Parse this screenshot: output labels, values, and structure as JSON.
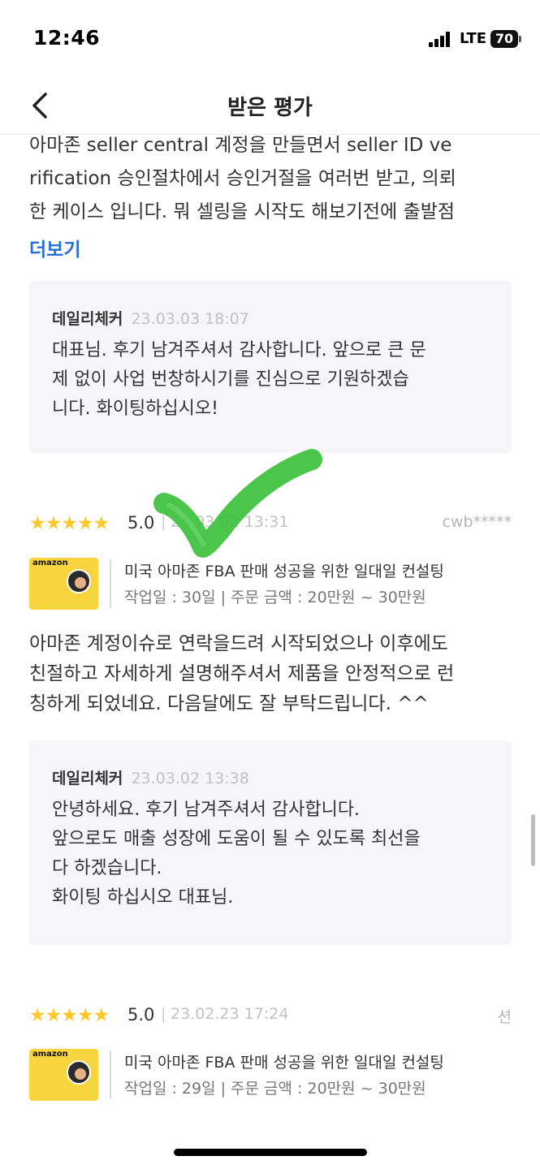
{
  "status_bar": {
    "time": "12:46",
    "network": "LTE",
    "battery": "70"
  },
  "header": {
    "title": "받은 평가"
  },
  "review_partial": {
    "lines": [
      "아마존 seller central 계정을 만들면서 seller ID ve",
      "rification 승인절차에서 승인거절을 여러번 받고, 의뢰",
      "한 케이스 입니다. 뭐 셀링을 시작도 해보기전에 출발점"
    ],
    "more_label": "더보기"
  },
  "reply1": {
    "author": "데일리체커",
    "date": "23.03.03 18:07",
    "lines": [
      "대표님. 후기 남겨주셔서 감사합니다. 앞으로 큰 문",
      "제 없이 사업 번창하시기를 진심으로 기원하겠습",
      "니다. 화이팅하십시오!"
    ]
  },
  "review2": {
    "stars": "★★★★★",
    "rating": "5.0",
    "date": "23.03.02 13:31",
    "user": "cwb*****",
    "product": {
      "thumb_brand": "amazon",
      "thumb_text": "",
      "title": "미국 아마존 FBA 판매 성공을 위한 일대일 컨설팅",
      "meta": "작업일 : 30일 | 주문 금액 : 20만원 ~ 30만원"
    },
    "lines": [
      "아마존 계정이슈로 연락을드려 시작되었으나 이후에도",
      "친절하고 자세하게 설명해주셔서 제품을 안정적으로 런",
      "칭하게 되었네요. 다음달에도 잘 부탁드립니다. ^^"
    ]
  },
  "reply2": {
    "author": "데일리체커",
    "date": "23.03.02 13:38",
    "lines": [
      "안녕하세요. 후기 남겨주셔서 감사합니다.",
      "앞으로도 매출 성장에 도움이 될 수 있도록 최선을",
      "다 하겠습니다.",
      "화이팅 하십시오 대표님."
    ]
  },
  "review3": {
    "stars": "★★★★★",
    "rating": "5.0",
    "date": "23.02.23 17:24",
    "user": "션",
    "product": {
      "thumb_brand": "amazon",
      "thumb_text": "",
      "title": "미국 아마존 FBA 판매 성공을 위한 일대일 컨설팅",
      "meta": "작업일 : 29일 | 주문 금액 : 20만원 ~ 30만원"
    }
  },
  "colors": {
    "star": "#ffc72c",
    "link": "#2a6fd6",
    "check": "#3cc13c",
    "reply_bg": "#f6f6f8"
  }
}
